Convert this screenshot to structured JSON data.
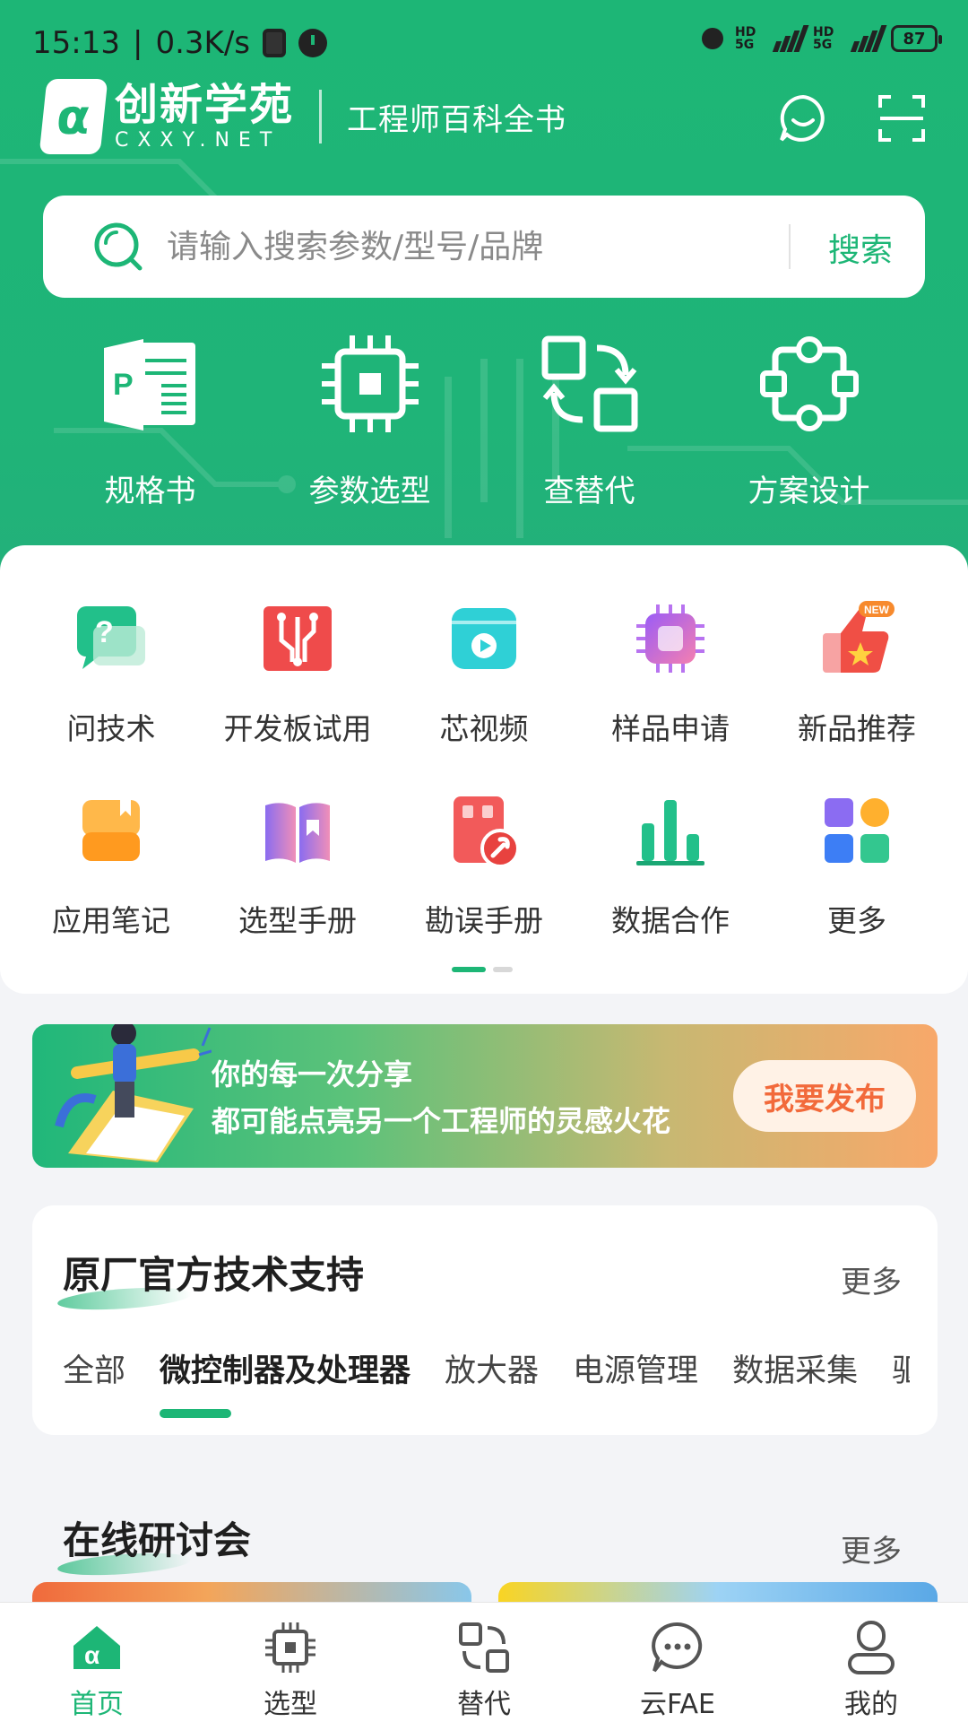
{
  "status_bar": {
    "time": "15:13",
    "speed": "0.3K/s",
    "battery": "87",
    "network_labels": [
      "HD 5G",
      "HD 5G"
    ]
  },
  "header": {
    "brand_name": "创新学苑",
    "brand_url": "CXXY.NET",
    "slogan": "工程师百科全书",
    "icons": [
      "chat-smile-icon",
      "scan-icon"
    ]
  },
  "search": {
    "placeholder": "请输入搜索参数/型号/品牌",
    "button": "搜索"
  },
  "quick_actions": [
    {
      "label": "规格书",
      "icon": "datasheet-icon"
    },
    {
      "label": "参数选型",
      "icon": "chip-icon"
    },
    {
      "label": "查替代",
      "icon": "replace-icon"
    },
    {
      "label": "方案设计",
      "icon": "solution-icon"
    }
  ],
  "grid": [
    {
      "label": "问技术",
      "icon": "question-icon"
    },
    {
      "label": "开发板试用",
      "icon": "devboard-icon"
    },
    {
      "label": "芯视频",
      "icon": "video-icon"
    },
    {
      "label": "样品申请",
      "icon": "sample-chip-icon"
    },
    {
      "label": "新品推荐",
      "icon": "thumbs-up-new-icon",
      "badge": "NEW"
    },
    {
      "label": "应用笔记",
      "icon": "notes-icon"
    },
    {
      "label": "选型手册",
      "icon": "manual-icon"
    },
    {
      "label": "勘误手册",
      "icon": "errata-icon"
    },
    {
      "label": "数据合作",
      "icon": "bar-chart-icon"
    },
    {
      "label": "更多",
      "icon": "more-grid-icon"
    }
  ],
  "banner": {
    "line1": "你的每一次分享",
    "line2": "都可能点亮另一个工程师的灵感火花",
    "button": "我要发布"
  },
  "support": {
    "title": "原厂官方技术支持",
    "more": "更多",
    "tabs": [
      "全部",
      "微控制器及处理器",
      "放大器",
      "电源管理",
      "数据采集",
      "驱"
    ],
    "active_tab": "微控制器及处理器"
  },
  "webinar": {
    "title": "在线研讨会",
    "more": "更多"
  },
  "bottom_nav": [
    {
      "label": "首页",
      "icon": "home-icon",
      "active": true
    },
    {
      "label": "选型",
      "icon": "chip-nav-icon",
      "active": false
    },
    {
      "label": "替代",
      "icon": "replace-nav-icon",
      "active": false
    },
    {
      "label": "云FAE",
      "icon": "chat-nav-icon",
      "active": false
    },
    {
      "label": "我的",
      "icon": "profile-icon",
      "active": false
    }
  ],
  "colors": {
    "brand_green": "#1db676",
    "publish_orange": "#f26a3b"
  }
}
